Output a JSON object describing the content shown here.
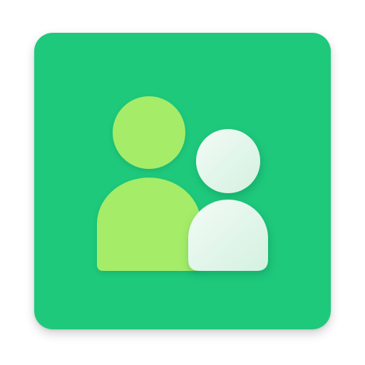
{
  "app": {
    "icon_name": "contacts-app-icon",
    "glyph": "people-icon"
  },
  "colors": {
    "tile_background": "#1ec97c",
    "primary_person": "#a5ec67",
    "secondary_person_top": "#f3fbf6",
    "secondary_person_bottom": "#d3f1e0",
    "page_background": "#ffffff"
  }
}
